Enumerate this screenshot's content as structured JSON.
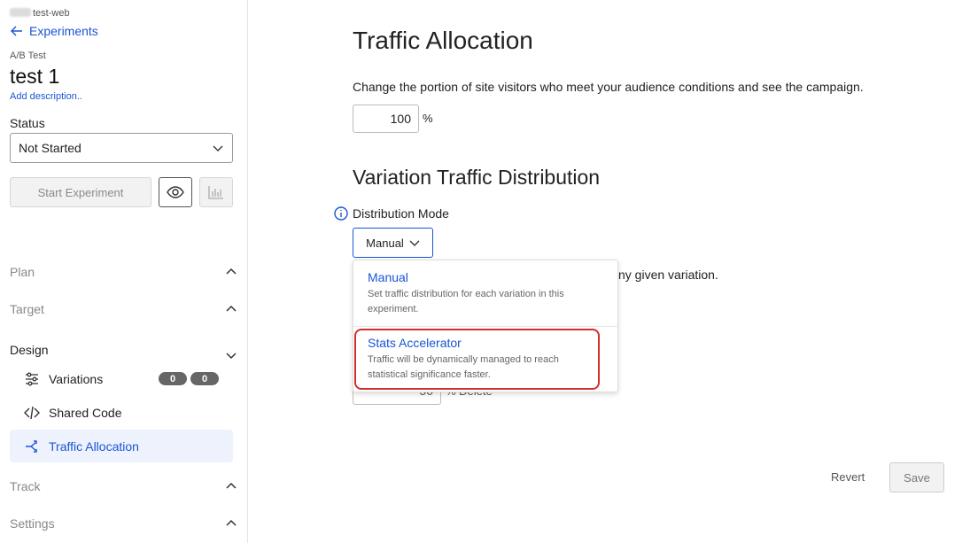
{
  "sidebar": {
    "project": "test-web",
    "back_label": "Experiments",
    "experiment_type": "A/B Test",
    "experiment_name": "test 1",
    "add_description": "Add description..",
    "status_label": "Status",
    "status_value": "Not Started",
    "start_button": "Start Experiment",
    "sections": {
      "plan": "Plan",
      "target": "Target",
      "design": "Design",
      "track": "Track",
      "settings": "Settings"
    },
    "design_items": {
      "variations": "Variations",
      "variations_badges": [
        "0",
        "0"
      ],
      "shared_code": "Shared Code",
      "traffic_allocation": "Traffic Allocation"
    }
  },
  "main": {
    "title": "Traffic Allocation",
    "description": "Change the portion of site visitors who meet your audience conditions and see the campaign.",
    "traffic_percent": "100",
    "percent_sign": "%",
    "distribution_title": "Variation Traffic Distribution",
    "distribution_mode_label": "Distribution Mode",
    "distribution_mode_value": "Manual",
    "obscured_text": "ny given variation.",
    "obscured_value": "50",
    "obscured_suffix": "%   Delete",
    "dropdown": {
      "options": [
        {
          "title": "Manual",
          "description": "Set traffic distribution for each variation in this experiment."
        },
        {
          "title": "Stats Accelerator",
          "description": "Traffic will be dynamically managed to reach statistical significance faster."
        }
      ]
    },
    "revert_label": "Revert",
    "save_label": "Save"
  },
  "colors": {
    "accent": "#1a55d6",
    "highlight": "#d32f2f"
  }
}
